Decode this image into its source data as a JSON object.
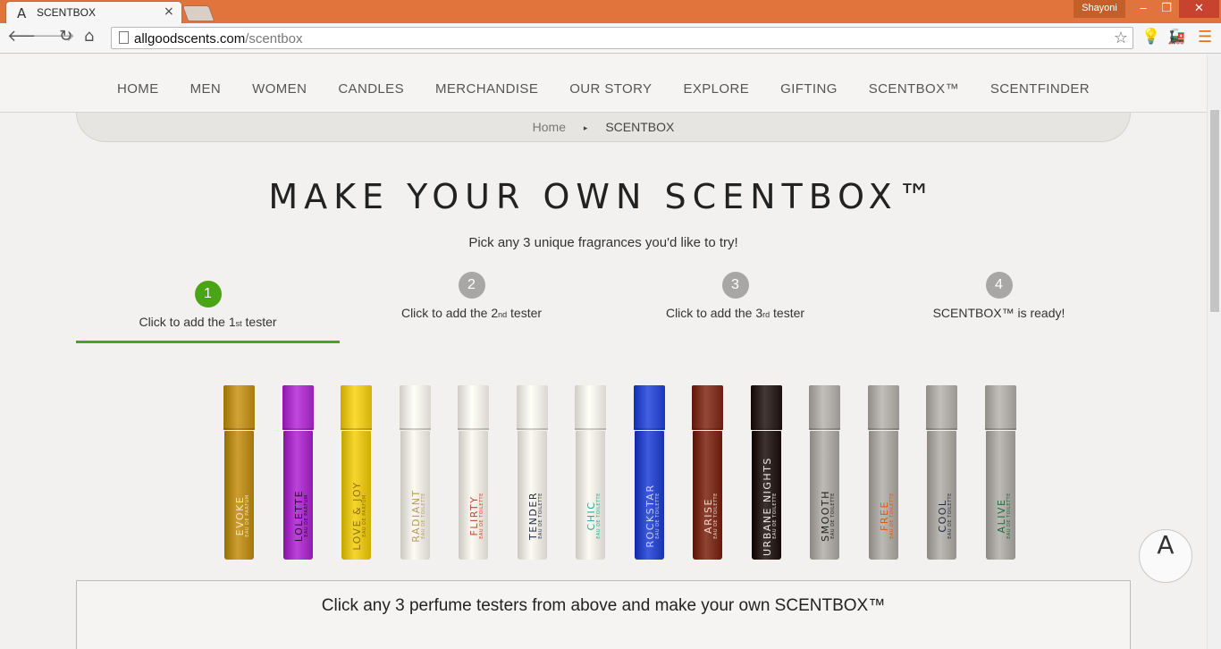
{
  "browser": {
    "tab_title": "SCENTBOX",
    "tab_logo": "A",
    "tab_close": "×",
    "profile_name": "Shayoni",
    "window_min": "‒",
    "window_max": "❐",
    "window_close": "✕",
    "url_domain": "allgoodscents.com",
    "url_path": "/scentbox",
    "icons": [
      "back-icon",
      "forward-icon",
      "reload-icon",
      "home-icon",
      "page-icon",
      "star-icon",
      "bulb-extension-icon",
      "train-extension-icon",
      "menu-icon"
    ]
  },
  "nav": {
    "items": [
      "HOME",
      "MEN",
      "WOMEN",
      "CANDLES",
      "MERCHANDISE",
      "OUR STORY",
      "EXPLORE",
      "GIFTING",
      "SCENTBOX™",
      "SCENTFINDER"
    ]
  },
  "breadcrumb": {
    "home": "Home",
    "separator": "▸",
    "current": "SCENTBOX"
  },
  "page": {
    "title": "MAKE YOUR OWN SCENTBOX™",
    "subtitle": "Pick any 3 unique fragrances you'd like to try!"
  },
  "steps": [
    {
      "num": "1",
      "pre": "Click to add the 1",
      "ord": "st",
      "post": " tester",
      "active": true
    },
    {
      "num": "2",
      "pre": "Click to add the 2",
      "ord": "nd",
      "post": " tester",
      "active": false
    },
    {
      "num": "3",
      "pre": "Click to add the 3",
      "ord": "rd",
      "post": " tester",
      "active": false
    },
    {
      "num": "4",
      "pre": "SCENTBOX™ is ready!",
      "ord": "",
      "post": "",
      "active": false
    }
  ],
  "testers": [
    {
      "name": "EVOKE",
      "sub": "EAU DE PARFUM",
      "color": "#b98a1e",
      "text": "#f3e3b0"
    },
    {
      "name": "LOLETTE",
      "sub": "EAU DE PARFUM",
      "color": "#a72fc6",
      "text": "#2a0a30"
    },
    {
      "name": "LOVE & JOY",
      "sub": "EAU DE PARFUM",
      "color": "#e2c21a",
      "text": "#8a6e10"
    },
    {
      "name": "RADIANT",
      "sub": "EAU DE TOILETTE",
      "color": "#e9e6df",
      "text": "#b89a5a"
    },
    {
      "name": "FLIRTY",
      "sub": "EAU DE TOILETTE",
      "color": "#e9e6df",
      "text": "#c2452a"
    },
    {
      "name": "TENDER",
      "sub": "EAU DE TOILETTE",
      "color": "#e9e6df",
      "text": "#22304a"
    },
    {
      "name": "CHIC",
      "sub": "EAU DE TOILETTE",
      "color": "#e9e6df",
      "text": "#2ba89a"
    },
    {
      "name": "ROCKSTAR",
      "sub": "EAU DE TOILETTE",
      "color": "#2b47c9",
      "text": "#c9d2f7"
    },
    {
      "name": "ARISE",
      "sub": "EAU DE TOILETTE",
      "color": "#7a2f1f",
      "text": "#f1d6cc"
    },
    {
      "name": "URBANE NIGHTS",
      "sub": "EAU DE TOILETTE",
      "color": "#2a1f1c",
      "text": "#efe9e6"
    },
    {
      "name": "SMOOTH",
      "sub": "EAU DE TOILETTE",
      "color": "#a9a6a1",
      "text": "#1e1e1e"
    },
    {
      "name": "FREE",
      "sub": "EAU DE TOILETTE",
      "color": "#a9a6a1",
      "text": "#d45a1f"
    },
    {
      "name": "COOL",
      "sub": "EAU DE TOILETTE",
      "color": "#a9a6a1",
      "text": "#1e2a44"
    },
    {
      "name": "ALIVE",
      "sub": "EAU DE TOILETTE",
      "color": "#a9a6a1",
      "text": "#1f6b3a"
    }
  ],
  "info": {
    "text": "Click any 3 perfume testers from above and make your own SCENTBOX™"
  },
  "fab_logo": "A",
  "colors": {
    "accent_green": "#4aa516",
    "titlebar": "#e0743c"
  }
}
